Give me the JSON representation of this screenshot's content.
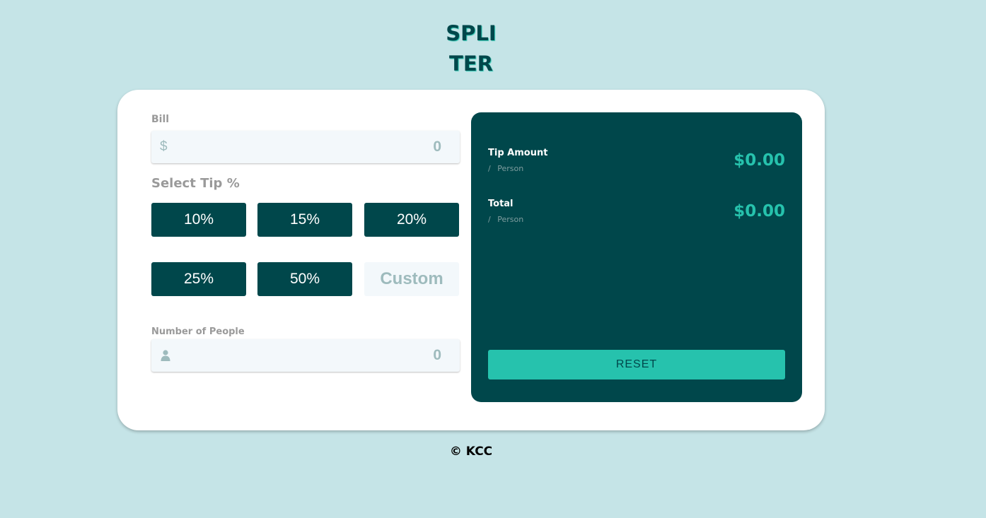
{
  "app": {
    "logo_line1": "SPLI",
    "logo_line2": "TER"
  },
  "bill": {
    "label": "Bill",
    "currency_symbol": "$",
    "placeholder": "0"
  },
  "tip": {
    "label": "Select Tip %",
    "options": [
      "10%",
      "15%",
      "20%",
      "25%",
      "50%"
    ],
    "custom_label": "Custom"
  },
  "people": {
    "label": "Number of People",
    "icon": "person-icon",
    "placeholder": "0"
  },
  "results": {
    "tip_amount": {
      "label": "Tip Amount",
      "sub": "/ Person",
      "value": "$0.00"
    },
    "total": {
      "label": "Total",
      "sub": "/ Person",
      "value": "$0.00"
    },
    "reset_label": "RESET"
  },
  "footer": {
    "text": "© KCC"
  },
  "colors": {
    "background": "#c5e4e7",
    "dark_teal": "#00474b",
    "accent": "#26c2ad",
    "input_bg": "#f3f8fb",
    "muted": "#9ebbbd"
  }
}
